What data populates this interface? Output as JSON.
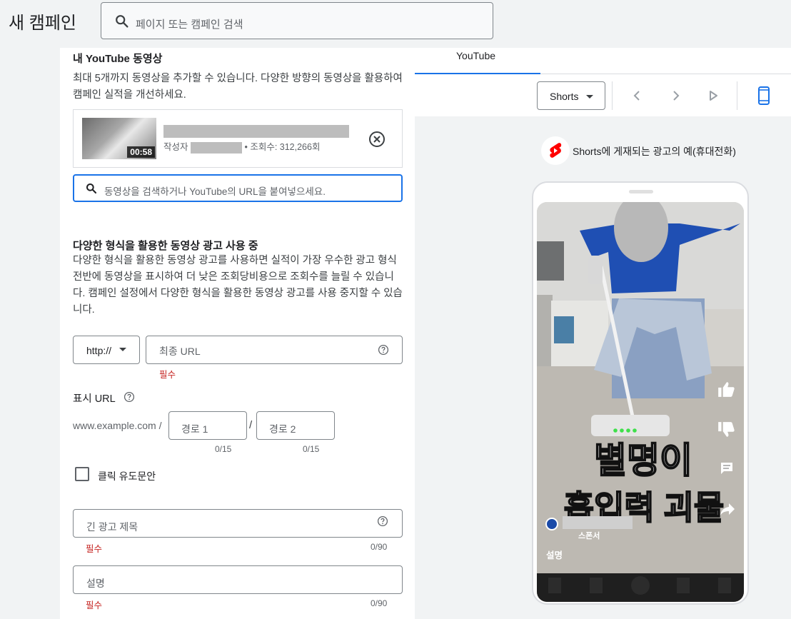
{
  "header": {
    "title": "새 캠페인",
    "search_placeholder": "페이지 또는 캠페인 검색"
  },
  "videos": {
    "heading": "내 YouTube 동영상",
    "description": "최대 5개까지 동영상을 추가할 수 있습니다. 다양한 방향의 동영상을 활용하여 캠페인 실적을 개선하세요.",
    "item": {
      "duration": "00:58",
      "author_prefix": "작성자",
      "views": "• 조회수: 312,266회"
    },
    "search_placeholder": "동영상을 검색하거나 YouTube의 URL을 붙여넣으세요."
  },
  "multiformat": {
    "heading": "다양한 형식을 활용한 동영상 광고 사용 중",
    "description": "다양한 형식을 활용한 동영상 광고를 사용하면 실적이 가장 우수한 광고 형식 전반에 동영상을 표시하여 더 낮은 조회당비용으로 조회수를 늘릴 수 있습니다. 캠페인 설정에서 다양한 형식을 활용한 동영상 광고를 사용 중지할 수 있습니다."
  },
  "final_url": {
    "protocol": "http://",
    "placeholder": "최종 URL",
    "required": "필수"
  },
  "display_url": {
    "label": "표시 URL",
    "domain": "www.example.com /",
    "separator": "/",
    "path1_placeholder": "경로 1",
    "path2_placeholder": "경로 2",
    "path1_count": "0/15",
    "path2_count": "0/15"
  },
  "cta": {
    "label": "클릭 유도문안"
  },
  "long_headline": {
    "placeholder": "긴 광고 제목",
    "required": "필수",
    "count": "0/90"
  },
  "description_field": {
    "placeholder": "설명",
    "required": "필수",
    "count": "0/90"
  },
  "preview": {
    "tab": "YouTube",
    "format_select": "Shorts",
    "caption": "Shorts에 게재되는 광고의 예(휴대전화)",
    "overlay_text_line1": "별명이",
    "overlay_text_line2": "흡입력 괴물",
    "sponsored": "스폰서",
    "desc": "설명"
  },
  "colors": {
    "accent": "#1a73e8",
    "required": "#c5221f",
    "shorts_red": "#ff0000"
  }
}
